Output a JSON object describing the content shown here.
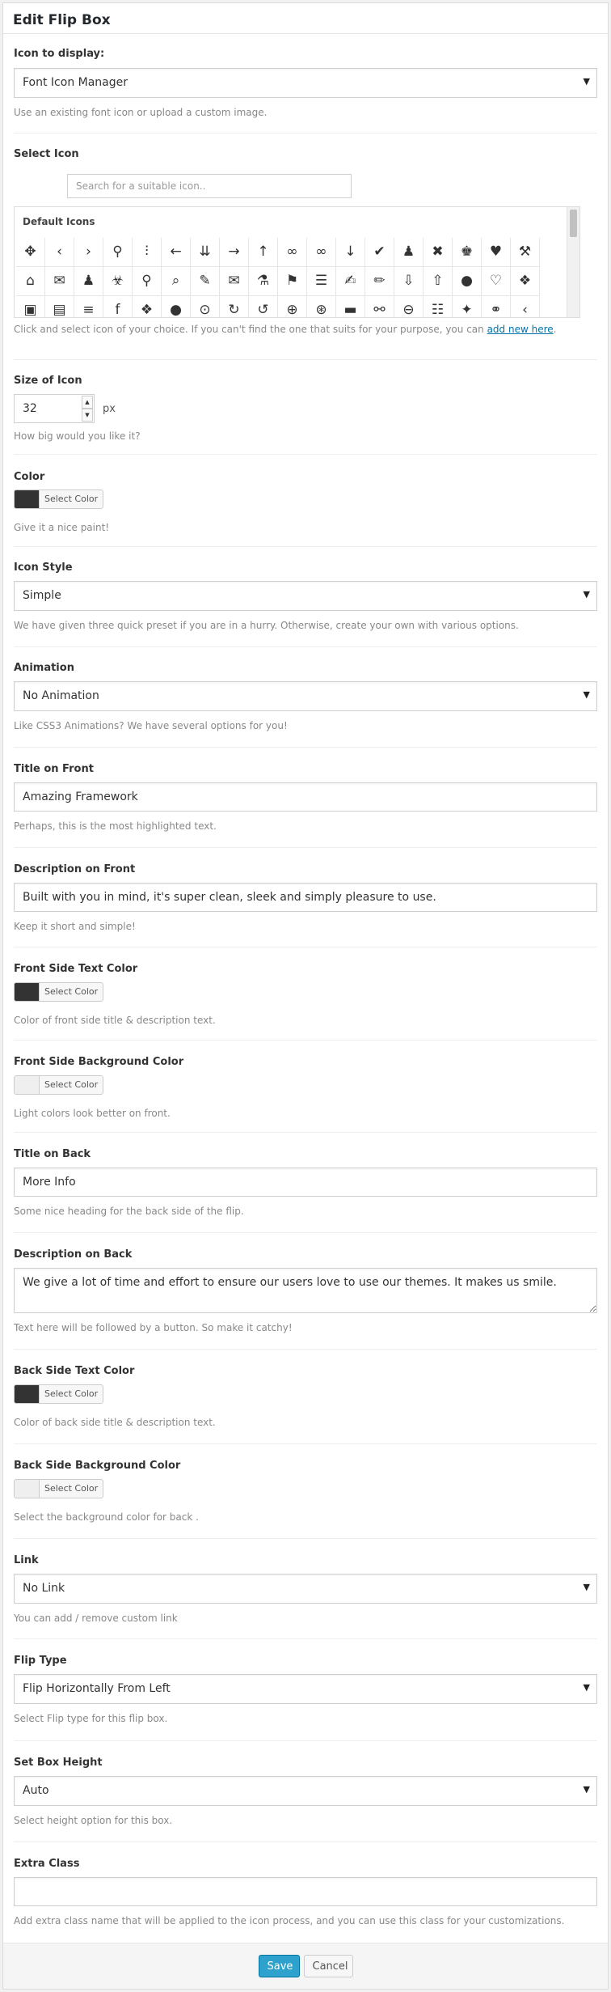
{
  "dialog": {
    "title": "Edit Flip Box",
    "save_label": "Save",
    "cancel_label": "Cancel"
  },
  "icon_display": {
    "label": "Icon to display:",
    "value": "Font Icon Manager",
    "help": "Use an existing font icon or upload a custom image."
  },
  "select_icon": {
    "label": "Select Icon",
    "search_placeholder": "Search for a suitable icon..",
    "group_title": "Default Icons",
    "help_prefix": "Click and select icon of your choice. If you can't find the one that suits for your purpose, you can ",
    "help_link": "add new here",
    "help_suffix": ".",
    "icons": [
      {
        "name": "move",
        "glyph": "✥"
      },
      {
        "name": "arrow-left-thin",
        "glyph": "‹"
      },
      {
        "name": "arrow-right-thin",
        "glyph": "›"
      },
      {
        "name": "pin",
        "glyph": "⚲"
      },
      {
        "name": "sliders-vertical",
        "glyph": "⫶"
      },
      {
        "name": "arrow-left",
        "glyph": "←"
      },
      {
        "name": "double-arrow-down",
        "glyph": "⇊"
      },
      {
        "name": "arrow-right",
        "glyph": "→"
      },
      {
        "name": "arrow-up",
        "glyph": "↑"
      },
      {
        "name": "glasses",
        "glyph": "∞"
      },
      {
        "name": "glasses-outline",
        "glyph": "∞"
      },
      {
        "name": "arrow-down",
        "glyph": "↓"
      },
      {
        "name": "check",
        "glyph": "✔"
      },
      {
        "name": "chess-pawn",
        "glyph": "♟"
      },
      {
        "name": "close",
        "glyph": "✖"
      },
      {
        "name": "chess-king",
        "glyph": "♚"
      },
      {
        "name": "heart",
        "glyph": "♥"
      },
      {
        "name": "gavel",
        "glyph": "⚒"
      },
      {
        "name": "home",
        "glyph": "⌂"
      },
      {
        "name": "chat-bubbles",
        "glyph": "✉"
      },
      {
        "name": "user",
        "glyph": "♟"
      },
      {
        "name": "biohazard",
        "glyph": "☣"
      },
      {
        "name": "search",
        "glyph": "⚲"
      },
      {
        "name": "search-box",
        "glyph": "⌕"
      },
      {
        "name": "brush",
        "glyph": "✎"
      },
      {
        "name": "envelope",
        "glyph": "✉"
      },
      {
        "name": "beaker",
        "glyph": "⚗"
      },
      {
        "name": "tags",
        "glyph": "⚑"
      },
      {
        "name": "hamburger",
        "glyph": "☰"
      },
      {
        "name": "edit",
        "glyph": "✍"
      },
      {
        "name": "pencil",
        "glyph": "✏"
      },
      {
        "name": "circle-arrow-down",
        "glyph": "⇩"
      },
      {
        "name": "circle-arrow-up",
        "glyph": "⇧"
      },
      {
        "name": "comment",
        "glyph": "●"
      },
      {
        "name": "heart-outline",
        "glyph": "♡"
      },
      {
        "name": "layers",
        "glyph": "❖"
      },
      {
        "name": "badge",
        "glyph": "▣"
      },
      {
        "name": "linkedin",
        "glyph": "▤"
      },
      {
        "name": "stack",
        "glyph": "≡"
      },
      {
        "name": "facebook",
        "glyph": "f"
      },
      {
        "name": "layers-outline",
        "glyph": "❖"
      },
      {
        "name": "comments",
        "glyph": "●"
      },
      {
        "name": "circle-down",
        "glyph": "⊙"
      },
      {
        "name": "circle-share",
        "glyph": "↻"
      },
      {
        "name": "refresh",
        "glyph": "↺"
      },
      {
        "name": "circle-up",
        "glyph": "⊕"
      },
      {
        "name": "circle-right",
        "glyph": "⊛"
      },
      {
        "name": "inbox",
        "glyph": "▬"
      },
      {
        "name": "nodes",
        "glyph": "⚯"
      },
      {
        "name": "circle-left",
        "glyph": "⊖"
      },
      {
        "name": "sliders",
        "glyph": "☷"
      },
      {
        "name": "twitter",
        "glyph": "✦"
      },
      {
        "name": "link",
        "glyph": "⚭"
      },
      {
        "name": "chevron-left",
        "glyph": "‹"
      }
    ]
  },
  "icon_size": {
    "label": "Size of Icon",
    "value": "32",
    "unit": "px",
    "help": "How big would you like it?"
  },
  "color": {
    "label": "Color",
    "swatch": "#333333",
    "button": "Select Color",
    "help": "Give it a nice paint!"
  },
  "icon_style": {
    "label": "Icon Style",
    "value": "Simple",
    "help": "We have given three quick preset if you are in a hurry. Otherwise, create your own with various options."
  },
  "animation": {
    "label": "Animation",
    "value": "No Animation",
    "help": "Like CSS3 Animations? We have several options for you!"
  },
  "title_front": {
    "label": "Title on Front",
    "value": "Amazing Framework",
    "help": "Perhaps, this is the most highlighted text."
  },
  "desc_front": {
    "label": "Description on Front",
    "value": "Built with you in mind, it's super clean, sleek and simply pleasure to use.",
    "help": "Keep it short and simple!"
  },
  "front_text_color": {
    "label": "Front Side Text Color",
    "swatch": "#333333",
    "button": "Select Color",
    "help": "Color of front side title & description text."
  },
  "front_bg_color": {
    "label": "Front Side Background Color",
    "swatch": "#efefef",
    "button": "Select Color",
    "help": "Light colors look better on front."
  },
  "title_back": {
    "label": "Title on Back",
    "value": "More Info",
    "help": "Some nice heading for the back side of the flip."
  },
  "desc_back": {
    "label": "Description on Back",
    "value": "We give a lot of time and effort to ensure our users love to use our themes. It makes us smile.",
    "help": "Text here will be followed by a button. So make it catchy!"
  },
  "back_text_color": {
    "label": "Back Side Text Color",
    "swatch": "#333333",
    "button": "Select Color",
    "help": "Color of back side title & description text."
  },
  "back_bg_color": {
    "label": "Back Side Background Color",
    "swatch": "#efefef",
    "button": "Select Color",
    "help": "Select the background color for back ."
  },
  "link": {
    "label": "Link",
    "value": "No Link",
    "help": "You can add / remove custom link"
  },
  "flip_type": {
    "label": "Flip Type",
    "value": "Flip Horizontally From Left",
    "help": "Select Flip type for this flip box."
  },
  "box_height": {
    "label": "Set Box Height",
    "value": "Auto",
    "help": "Select height option for this box."
  },
  "extra_class": {
    "label": "Extra Class",
    "value": "",
    "help": "Add extra class name that will be applied to the icon process, and you can use this class for your customizations."
  }
}
